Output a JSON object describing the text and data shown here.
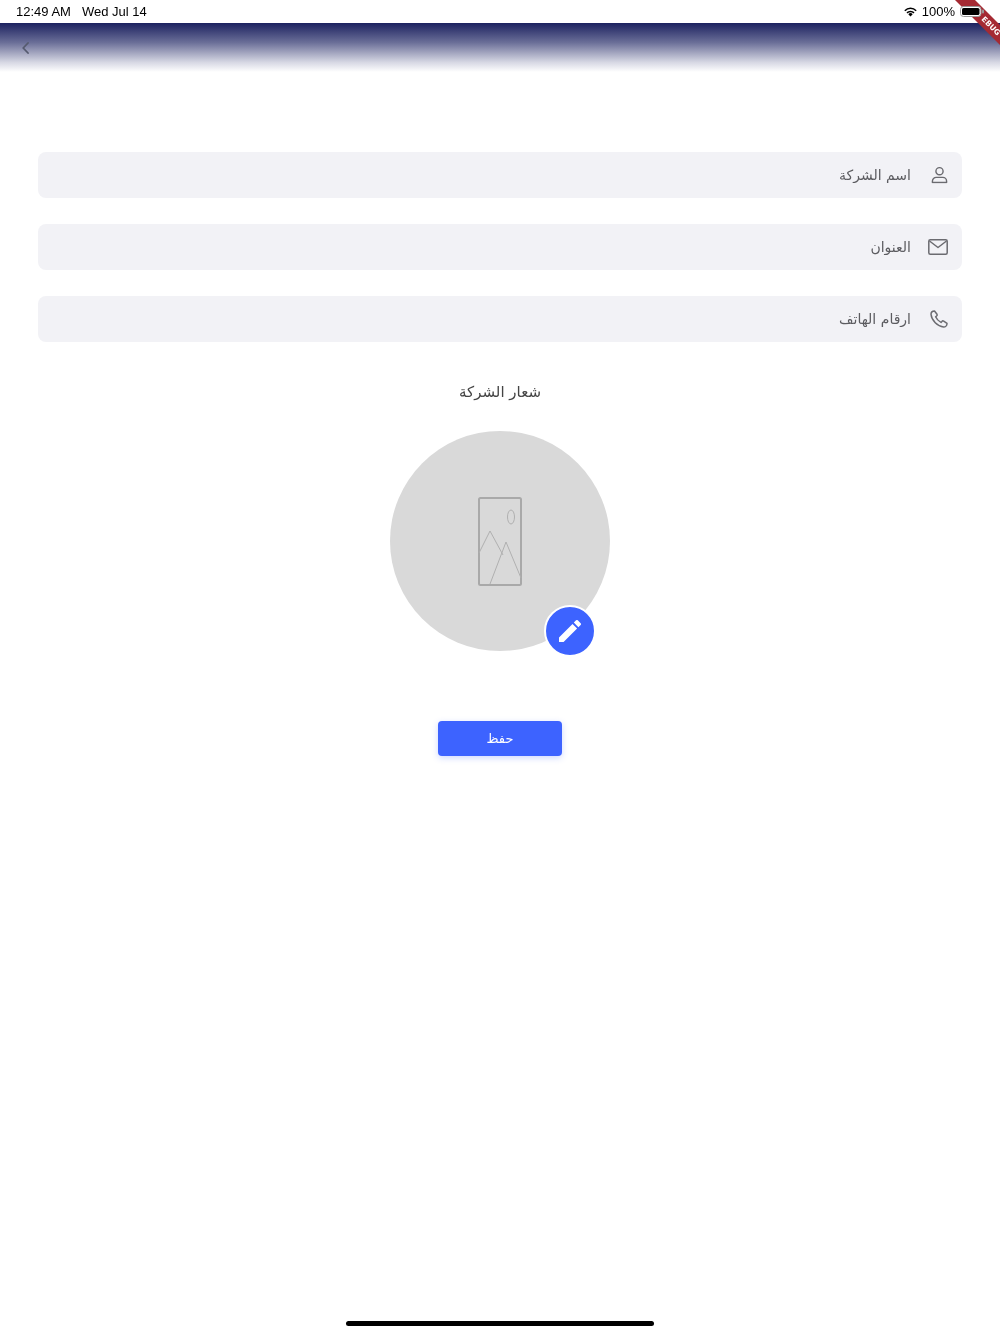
{
  "status_bar": {
    "time": "12:49 AM",
    "date": "Wed Jul 14",
    "battery": "100%"
  },
  "debug_banner": {
    "text": "EBUG"
  },
  "fields": [
    {
      "kind": "person",
      "placeholder": "اسم الشركة"
    },
    {
      "kind": "mail",
      "placeholder": "العنوان"
    },
    {
      "kind": "phone",
      "placeholder": "ارقام الهاتف"
    }
  ],
  "logo": {
    "label": "شعار الشركة"
  },
  "save_button": {
    "label": "حفظ"
  }
}
